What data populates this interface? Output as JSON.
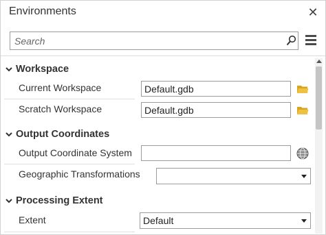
{
  "window": {
    "title": "Environments",
    "close_glyph": "✕"
  },
  "search": {
    "placeholder": "Search",
    "value": ""
  },
  "icons": {
    "search": "search-icon",
    "menu": "menu-icon",
    "close": "close-icon",
    "folder": "folder-icon",
    "globe": "globe-icon",
    "chevron": "chevron-down-icon"
  },
  "colors": {
    "folder": "#f0c040",
    "folder_dark": "#d9a521",
    "scroll_thumb": "#c5c5c5"
  },
  "sections": {
    "workspace": {
      "label": "Workspace",
      "rows": {
        "current": {
          "label": "Current Workspace",
          "value": "Default.gdb"
        },
        "scratch": {
          "label": "Scratch Workspace",
          "value": "Default.gdb"
        }
      }
    },
    "output_coordinates": {
      "label": "Output Coordinates",
      "rows": {
        "system": {
          "label": "Output Coordinate System",
          "value": ""
        },
        "transforms": {
          "label": "Geographic Transformations",
          "value": ""
        }
      }
    },
    "processing_extent": {
      "label": "Processing Extent",
      "rows": {
        "extent": {
          "label": "Extent",
          "value": "Default"
        }
      }
    }
  }
}
